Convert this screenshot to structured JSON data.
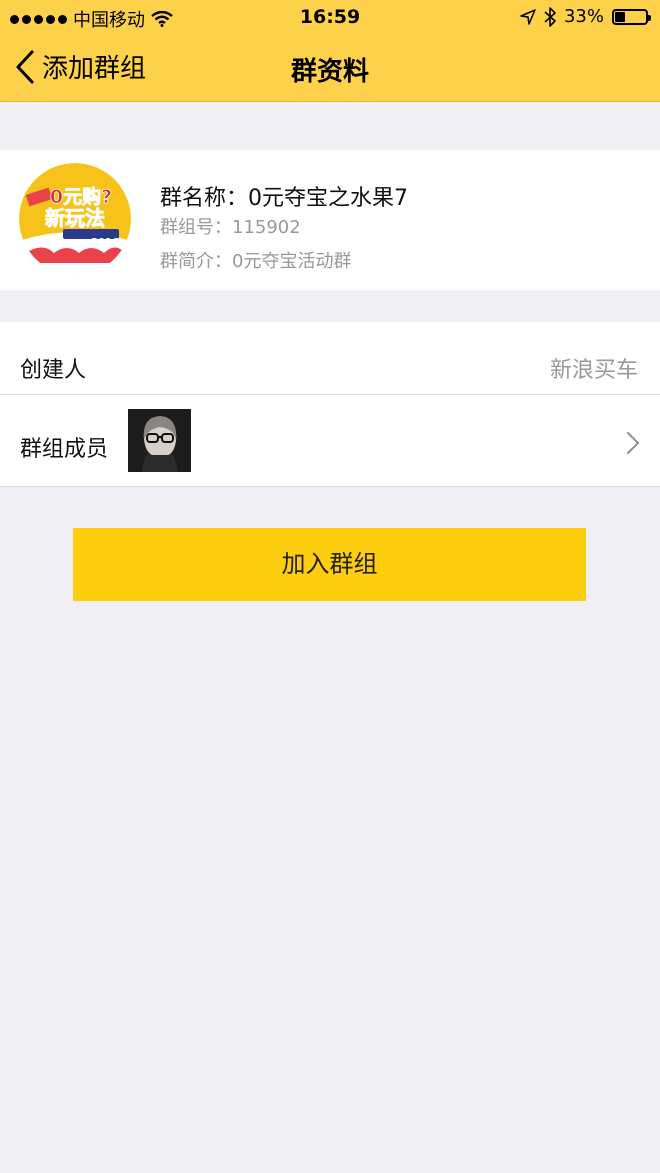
{
  "status_bar": {
    "carrier": "中国移动",
    "time": "16:59",
    "battery_text": "33%",
    "battery_level": 0.33
  },
  "nav": {
    "back_label": "添加群组",
    "title": "群资料"
  },
  "group": {
    "name": "群名称：0元夺宝之水果7",
    "id": "群组号：115902",
    "description": "群简介：0元夺宝活动群",
    "avatar_text": {
      "line1": "0元购?",
      "line2": "新玩法",
      "line3": "2016"
    }
  },
  "info": {
    "creator_label": "创建人",
    "creator_value": "新浪买车",
    "members_label": "群组成员"
  },
  "join_button_label": "加入群组",
  "colors": {
    "accent": "#fdd24a",
    "button": "#fdcd10",
    "background": "#efeff4"
  }
}
